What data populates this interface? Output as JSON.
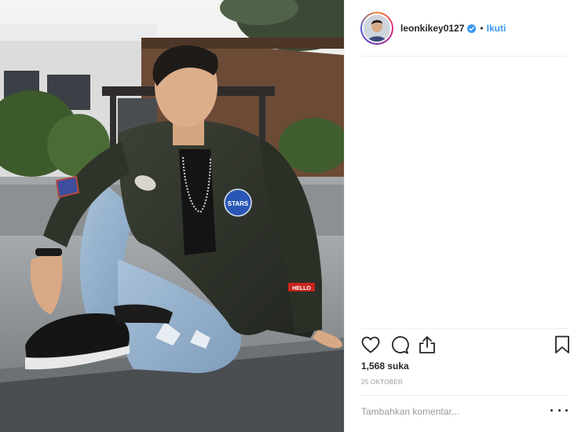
{
  "post": {
    "username": "leonkikey0127",
    "verified": true,
    "separator": "•",
    "follow_label": "Ikuti",
    "likes_text": "1,568 suka",
    "date_text": "25 OKTOBER",
    "comment_placeholder": "Tambahkan komentar...",
    "photo_patches": [
      "STARS",
      "HELLO"
    ]
  },
  "actions": {
    "like_icon": "heart-icon",
    "comment_icon": "comment-icon",
    "share_icon": "share-icon",
    "save_icon": "bookmark-icon",
    "more_icon": "more-options-icon"
  },
  "colors": {
    "accent": "#3897f0",
    "text": "#262626",
    "muted": "#999999",
    "divider": "#efefef"
  }
}
